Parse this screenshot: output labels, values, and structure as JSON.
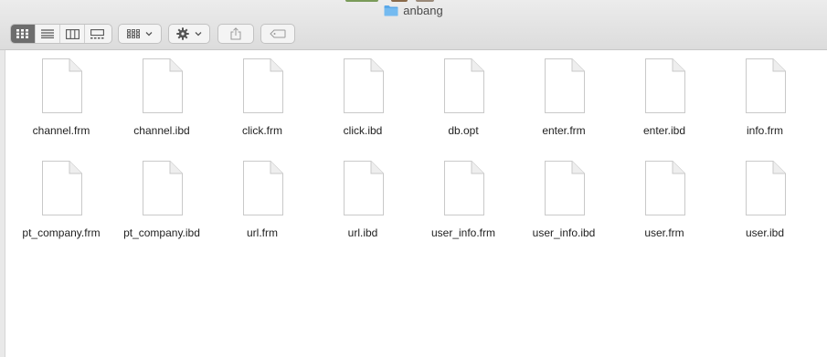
{
  "window": {
    "title": "anbang",
    "title_icon": "folder-icon"
  },
  "toolbar": {
    "view_buttons": [
      {
        "name": "icon-view-button",
        "icon": "grid-icon",
        "active": true
      },
      {
        "name": "list-view-button",
        "icon": "list-icon",
        "active": false
      },
      {
        "name": "column-view-button",
        "icon": "columns-icon",
        "active": false
      },
      {
        "name": "gallery-view-button",
        "icon": "gallery-icon",
        "active": false
      }
    ],
    "group_button_icon": "grid-icon",
    "action_button_icon": "gear-icon",
    "share_button_icon": "share-icon",
    "tag_button_icon": "tag-icon"
  },
  "files": [
    {
      "name": "channel.frm"
    },
    {
      "name": "channel.ibd"
    },
    {
      "name": "click.frm"
    },
    {
      "name": "click.ibd"
    },
    {
      "name": "db.opt"
    },
    {
      "name": "enter.frm"
    },
    {
      "name": "enter.ibd"
    },
    {
      "name": "info.frm"
    },
    {
      "name": "pt_company.frm"
    },
    {
      "name": "pt_company.ibd"
    },
    {
      "name": "url.frm"
    },
    {
      "name": "url.ibd"
    },
    {
      "name": "user_info.frm"
    },
    {
      "name": "user_info.ibd"
    },
    {
      "name": "user.frm"
    },
    {
      "name": "user.ibd"
    }
  ],
  "colors": {
    "folder": "#5aa8e8",
    "active_view": "#6d6d6d",
    "titlebar": "#e4e4e4"
  }
}
